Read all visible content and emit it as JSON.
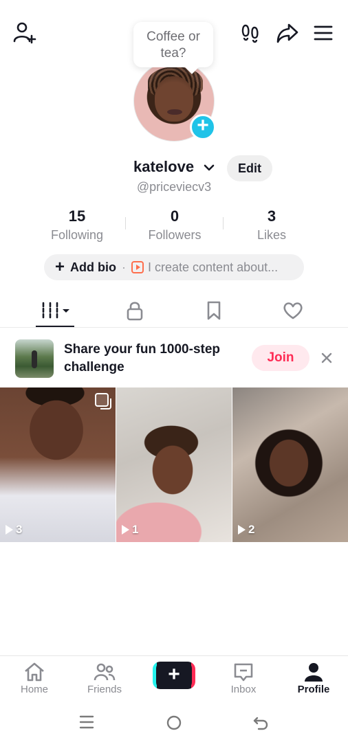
{
  "top_bar": {
    "add_friend_icon": "person-plus-icon",
    "footprint_icon": "footprints-icon",
    "share_icon": "share-arrow-icon",
    "menu_icon": "hamburger-menu-icon"
  },
  "bubble": {
    "line1": "Coffee or",
    "line2": "tea?"
  },
  "profile": {
    "username": "katelove",
    "edit_label": "Edit",
    "handle": "@priceviecv3"
  },
  "stats": [
    {
      "value": "15",
      "label": "Following"
    },
    {
      "value": "0",
      "label": "Followers"
    },
    {
      "value": "3",
      "label": "Likes"
    }
  ],
  "bio": {
    "add_label": "Add bio",
    "separator": "·",
    "placeholder": "I create content about..."
  },
  "tabs": [
    {
      "icon": "grid-icon",
      "active": true
    },
    {
      "icon": "lock-icon",
      "active": false
    },
    {
      "icon": "bookmark-icon",
      "active": false
    },
    {
      "icon": "heart-icon",
      "active": false
    }
  ],
  "challenge": {
    "text": "Share your fun 1000-step challenge",
    "join_label": "Join"
  },
  "videos": [
    {
      "views": "3"
    },
    {
      "views": "1"
    },
    {
      "views": "2"
    }
  ],
  "bottom_nav": {
    "home": "Home",
    "friends": "Friends",
    "create": "+",
    "inbox": "Inbox",
    "profile": "Profile"
  },
  "colors": {
    "accent": "#fe2c55",
    "cyan": "#25f4ee",
    "text_primary": "#161823",
    "text_secondary": "#8a8b91"
  }
}
